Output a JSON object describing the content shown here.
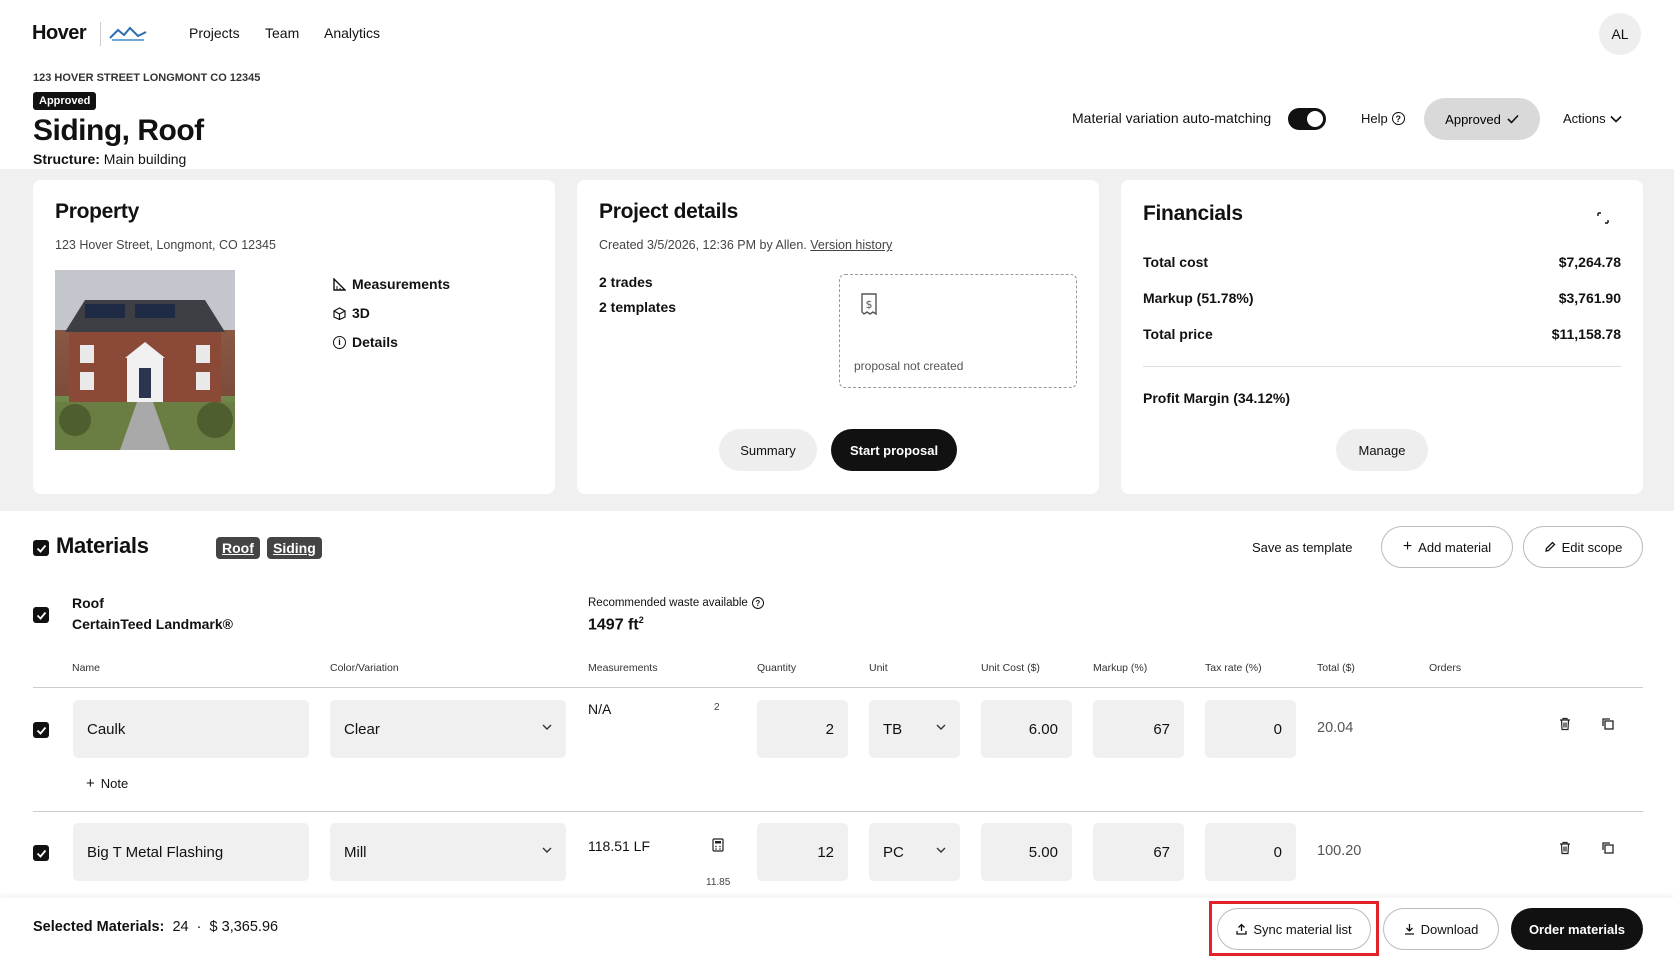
{
  "nav": {
    "logo": "Hover",
    "links": [
      "Projects",
      "Team",
      "Analytics"
    ],
    "avatar": "AL"
  },
  "header": {
    "address": "123 HOVER STREET LONGMONT CO 12345",
    "status_badge": "Approved",
    "title": "Siding, Roof",
    "structure_label": "Structure:",
    "structure_value": "Main building",
    "auto_match_label": "Material variation auto-matching",
    "auto_match_on": true,
    "help_label": "Help",
    "approved_button": "Approved",
    "actions_label": "Actions"
  },
  "property": {
    "title": "Property",
    "address": "123 Hover Street, Longmont, CO 12345",
    "links": [
      "Measurements",
      "3D",
      "Details"
    ]
  },
  "project_details": {
    "title": "Project details",
    "created": "Created 3/5/2026, 12:36 PM by Allen.",
    "version_history": "Version history",
    "trades": "2 trades",
    "templates": "2 templates",
    "proposal_status": "proposal not created",
    "summary_button": "Summary",
    "start_proposal_button": "Start proposal"
  },
  "financials": {
    "title": "Financials",
    "rows": [
      {
        "label": "Total cost",
        "value": "$7,264.78"
      },
      {
        "label": "Markup (51.78%)",
        "value": "$3,761.90"
      },
      {
        "label": "Total price",
        "value": "$11,158.78"
      }
    ],
    "profit_margin": "Profit Margin (34.12%)",
    "manage_button": "Manage"
  },
  "materials": {
    "title": "Materials",
    "tags": [
      "Roof",
      "Siding"
    ],
    "save_template": "Save as template",
    "add_material": "Add material",
    "edit_scope": "Edit scope",
    "section": {
      "trade": "Roof",
      "product": "CertainTeed Landmark®",
      "waste_label": "Recommended waste available",
      "waste_value": "1497",
      "waste_unit": "ft",
      "waste_exp": "2"
    },
    "columns": [
      "Name",
      "Color/Variation",
      "Measurements",
      "Quantity",
      "Unit",
      "Unit Cost ($)",
      "Markup (%)",
      "Tax rate (%)",
      "Total ($)",
      "Orders"
    ],
    "rows": [
      {
        "name": "Caulk",
        "color": "Clear",
        "measurement": "N/A",
        "meas_side": "2",
        "meas_sub": "",
        "quantity": "2",
        "unit": "TB",
        "unit_cost": "6.00",
        "markup": "67",
        "tax": "0",
        "total": "20.04",
        "note": "Note"
      },
      {
        "name": "Big T Metal Flashing",
        "color": "Mill",
        "measurement": "118.51 LF",
        "meas_side": "",
        "meas_sub": "11.85",
        "quantity": "12",
        "unit": "PC",
        "unit_cost": "5.00",
        "markup": "67",
        "tax": "0",
        "total": "100.20",
        "note": ""
      }
    ]
  },
  "footer": {
    "selected_label": "Selected Materials:",
    "selected_count": "24",
    "separator": "·",
    "selected_total": "$ 3,365.96",
    "sync_button": "Sync material list",
    "download_button": "Download",
    "order_button": "Order materials"
  }
}
